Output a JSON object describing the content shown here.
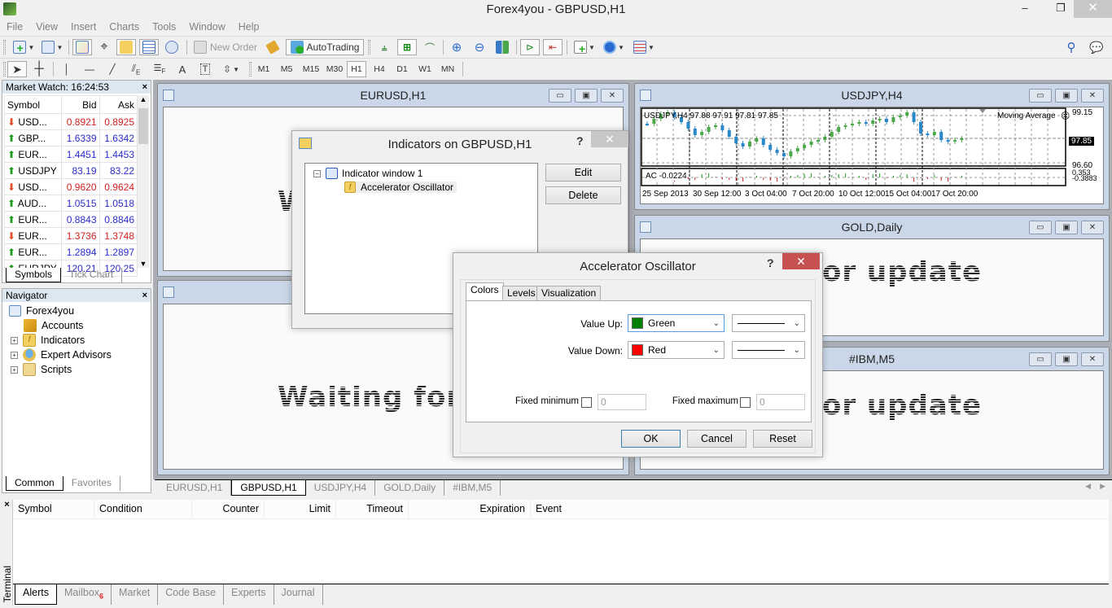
{
  "window": {
    "title": "Forex4you - GBPUSD,H1",
    "minimize": "–",
    "restore": "❐",
    "close": "✕"
  },
  "menu": [
    "File",
    "View",
    "Insert",
    "Charts",
    "Tools",
    "Window",
    "Help"
  ],
  "toolbar": {
    "new_order": "New Order",
    "autotrading": "AutoTrading",
    "timeframes": [
      "M1",
      "M5",
      "M15",
      "M30",
      "H1",
      "H4",
      "D1",
      "W1",
      "MN"
    ],
    "active_timeframe": "H1",
    "text_tool": "A"
  },
  "market_watch": {
    "title": "Market Watch: 16:24:53",
    "close": "×",
    "columns": [
      "Symbol",
      "Bid",
      "Ask"
    ],
    "rows": [
      {
        "dir": "down",
        "symbol": "USD...",
        "bid": "0.8921",
        "ask": "0.8925"
      },
      {
        "dir": "up",
        "symbol": "GBP...",
        "bid": "1.6339",
        "ask": "1.6342"
      },
      {
        "dir": "up",
        "symbol": "EUR...",
        "bid": "1.4451",
        "ask": "1.4453"
      },
      {
        "dir": "up",
        "symbol": "USDJPY",
        "bid": "83.19",
        "ask": "83.22"
      },
      {
        "dir": "down",
        "symbol": "USD...",
        "bid": "0.9620",
        "ask": "0.9624"
      },
      {
        "dir": "up",
        "symbol": "AUD...",
        "bid": "1.0515",
        "ask": "1.0518"
      },
      {
        "dir": "up",
        "symbol": "EUR...",
        "bid": "0.8843",
        "ask": "0.8846"
      },
      {
        "dir": "down",
        "symbol": "EUR...",
        "bid": "1.3736",
        "ask": "1.3748"
      },
      {
        "dir": "up",
        "symbol": "EUR...",
        "bid": "1.2894",
        "ask": "1.2897"
      },
      {
        "dir": "up",
        "symbol": "EURJPY",
        "bid": "120.21",
        "ask": "120.25"
      }
    ],
    "tabs": [
      "Symbols",
      "Tick Chart"
    ]
  },
  "navigator": {
    "title": "Navigator",
    "close": "×",
    "root": "Forex4you",
    "items": [
      "Accounts",
      "Indicators",
      "Expert Advisors",
      "Scripts"
    ],
    "tabs": [
      "Common",
      "Favorites"
    ]
  },
  "charts": {
    "eurusd": {
      "title": "EURUSD,H1",
      "waiting": "Waiting for update"
    },
    "gbpusd": {
      "title": "GBPUSD,H1",
      "waiting": "Waiting for update"
    },
    "usdjpy": {
      "title": "USDJPY,H4",
      "header": "USDJPY,H4  97.88 97.91 97.81 97.85",
      "indicator_label": "Moving Average",
      "ac_label": "AC -0.0224",
      "price_high": "99.15",
      "price_current": "97.85",
      "price_low": "96.60",
      "ac_high": "0.353",
      "ac_low": "-0.3883",
      "x_labels": [
        "25 Sep 2013",
        "30 Sep 12:00",
        "3 Oct 04:00",
        "7 Oct 20:00",
        "10 Oct 12:00",
        "15 Oct 04:00",
        "17 Oct 20:00"
      ]
    },
    "gold": {
      "title": "GOLD,Daily",
      "waiting": "Waiting for update"
    },
    "ibm": {
      "title": "#IBM,M5",
      "waiting": "Waiting for update"
    }
  },
  "chart_tabs": [
    "EURUSD,H1",
    "GBPUSD,H1",
    "USDJPY,H4",
    "GOLD,Daily",
    "#IBM,M5"
  ],
  "chart_tabs_active": "GBPUSD,H1",
  "indicators_dialog": {
    "title": "Indicators on GBPUSD,H1",
    "help": "?",
    "close": "✕",
    "tree_window": "Indicator window 1",
    "tree_indicator": "Accelerator Oscillator",
    "edit": "Edit",
    "delete": "Delete"
  },
  "ac_dialog": {
    "title": "Accelerator Oscillator",
    "help": "?",
    "close": "✕",
    "tabs": [
      "Colors",
      "Levels",
      "Visualization"
    ],
    "active_tab": "Colors",
    "value_up_label": "Value Up:",
    "value_up_color": "Green",
    "value_up_hex": "#008000",
    "value_down_label": "Value Down:",
    "value_down_color": "Red",
    "value_down_hex": "#ff0000",
    "fixed_min_label": "Fixed minimum",
    "fixed_min_value": "0",
    "fixed_max_label": "Fixed maximum",
    "fixed_max_value": "0",
    "ok": "OK",
    "cancel": "Cancel",
    "reset": "Reset"
  },
  "terminal": {
    "side_label": "Terminal",
    "close": "×",
    "columns": [
      "Symbol",
      "Condition",
      "Counter",
      "Limit",
      "Timeout",
      "Expiration",
      "Event"
    ],
    "tabs": [
      "Alerts",
      "Mailbox",
      "Market",
      "Code Base",
      "Experts",
      "Journal"
    ],
    "mailbox_count": "6",
    "active_tab": "Alerts"
  }
}
